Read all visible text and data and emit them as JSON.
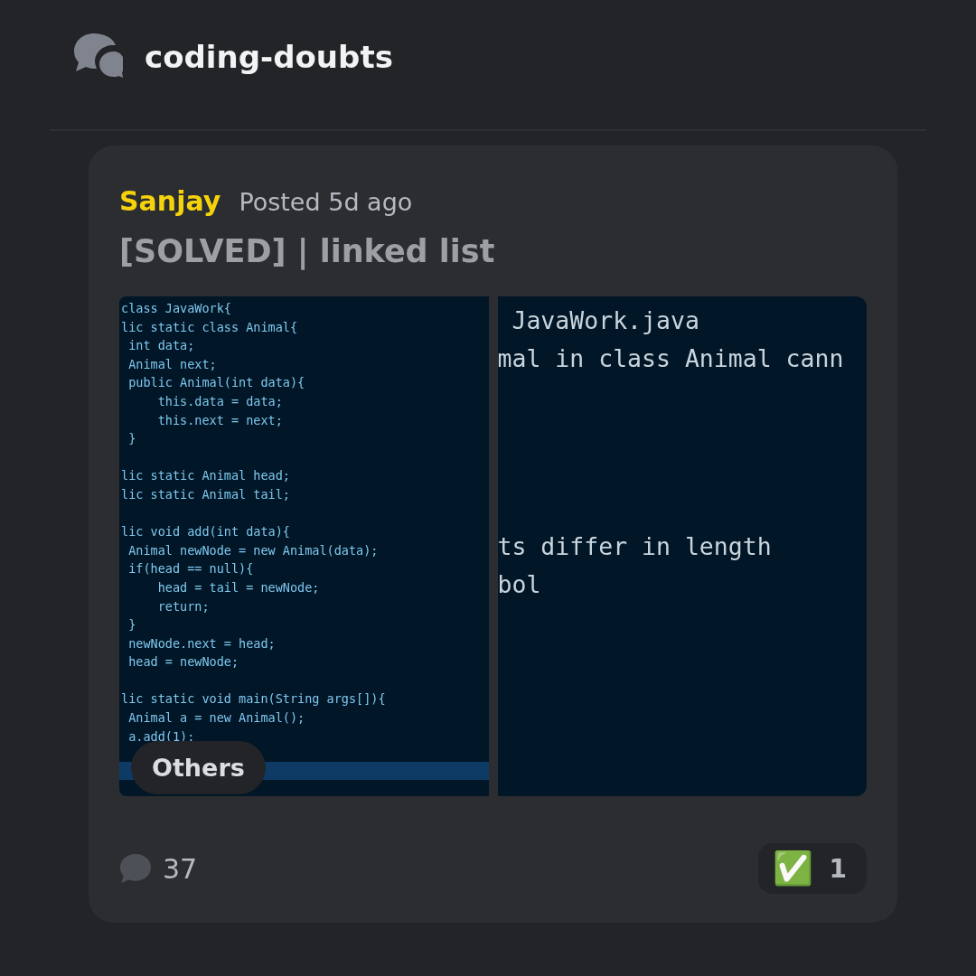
{
  "channel": {
    "name": "coding-doubts"
  },
  "post": {
    "author": "Sanjay",
    "meta": "Posted 5d ago",
    "title": "[SOLVED] | linked list",
    "code_blocks": [
      [
        "class JavaWork{",
        "lic static class Animal{",
        " int data;",
        " Animal next;",
        " public Animal(int data){",
        "     this.data = data;",
        "     this.next = next;",
        " }"
      ],
      [
        "lic static Animal head;",
        "lic static Animal tail;"
      ],
      [
        "lic void add(int data){",
        " Animal newNode = new Animal(data);",
        " if(head == null){",
        "     head = tail = newNode;",
        "     return;",
        " }",
        " newNode.next = head;",
        " head = newNode;"
      ],
      [
        "lic static void main(String args[]){",
        " Animal a = new Animal();",
        " a.add(1);"
      ]
    ],
    "terminal_blocks": [
      [
        " JavaWork.java",
        "mal in class Animal cann"
      ],
      [
        "ts differ in length",
        "bol"
      ]
    ],
    "tag": "Others",
    "reply_count": "37",
    "reaction": {
      "emoji": "✅",
      "count": "1"
    }
  }
}
